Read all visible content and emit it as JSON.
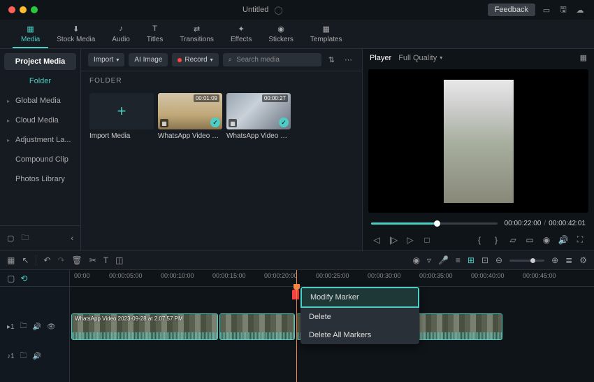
{
  "titlebar": {
    "title": "Untitled",
    "feedback": "Feedback"
  },
  "tabs": [
    {
      "label": "Media",
      "icon": "📁"
    },
    {
      "label": "Stock Media",
      "icon": "⬇"
    },
    {
      "label": "Audio",
      "icon": "♪"
    },
    {
      "label": "Titles",
      "icon": "T"
    },
    {
      "label": "Transitions",
      "icon": "⇄"
    },
    {
      "label": "Effects",
      "icon": "✦"
    },
    {
      "label": "Stickers",
      "icon": "◉"
    },
    {
      "label": "Templates",
      "icon": "▦"
    }
  ],
  "sidebar": {
    "project_media": "Project Media",
    "folder": "Folder",
    "items": [
      "Global Media",
      "Cloud Media",
      "Adjustment La...",
      "Compound Clip",
      "Photos Library"
    ]
  },
  "media_toolbar": {
    "import": "Import",
    "ai_image": "AI Image",
    "record": "Record",
    "search_placeholder": "Search media"
  },
  "media_panel": {
    "folder_header": "FOLDER",
    "items": [
      {
        "label": "Import Media",
        "type": "import"
      },
      {
        "label": "WhatsApp Video 202...",
        "duration": "00:01:09"
      },
      {
        "label": "WhatsApp Video 202...",
        "duration": "00:00:27"
      }
    ]
  },
  "player": {
    "tab": "Player",
    "quality": "Full Quality",
    "current_time": "00:00:22:00",
    "total_time": "00:00:42:01"
  },
  "ruler": [
    "00:00",
    "00:00:05:00",
    "00:00:10:00",
    "00:00:15:00",
    "00:00:20:00",
    "00:00:25:00",
    "00:00:30:00",
    "00:00:35:00",
    "00:00:40:00",
    "00:00:45:00"
  ],
  "clips": {
    "main": "WhatsApp Video 2023-09-28 at 2.07.57 PM"
  },
  "tracks": {
    "video": "▸1",
    "audio": "♪1"
  },
  "context_menu": {
    "modify": "Modify Marker",
    "delete": "Delete",
    "delete_all": "Delete All Markers"
  }
}
